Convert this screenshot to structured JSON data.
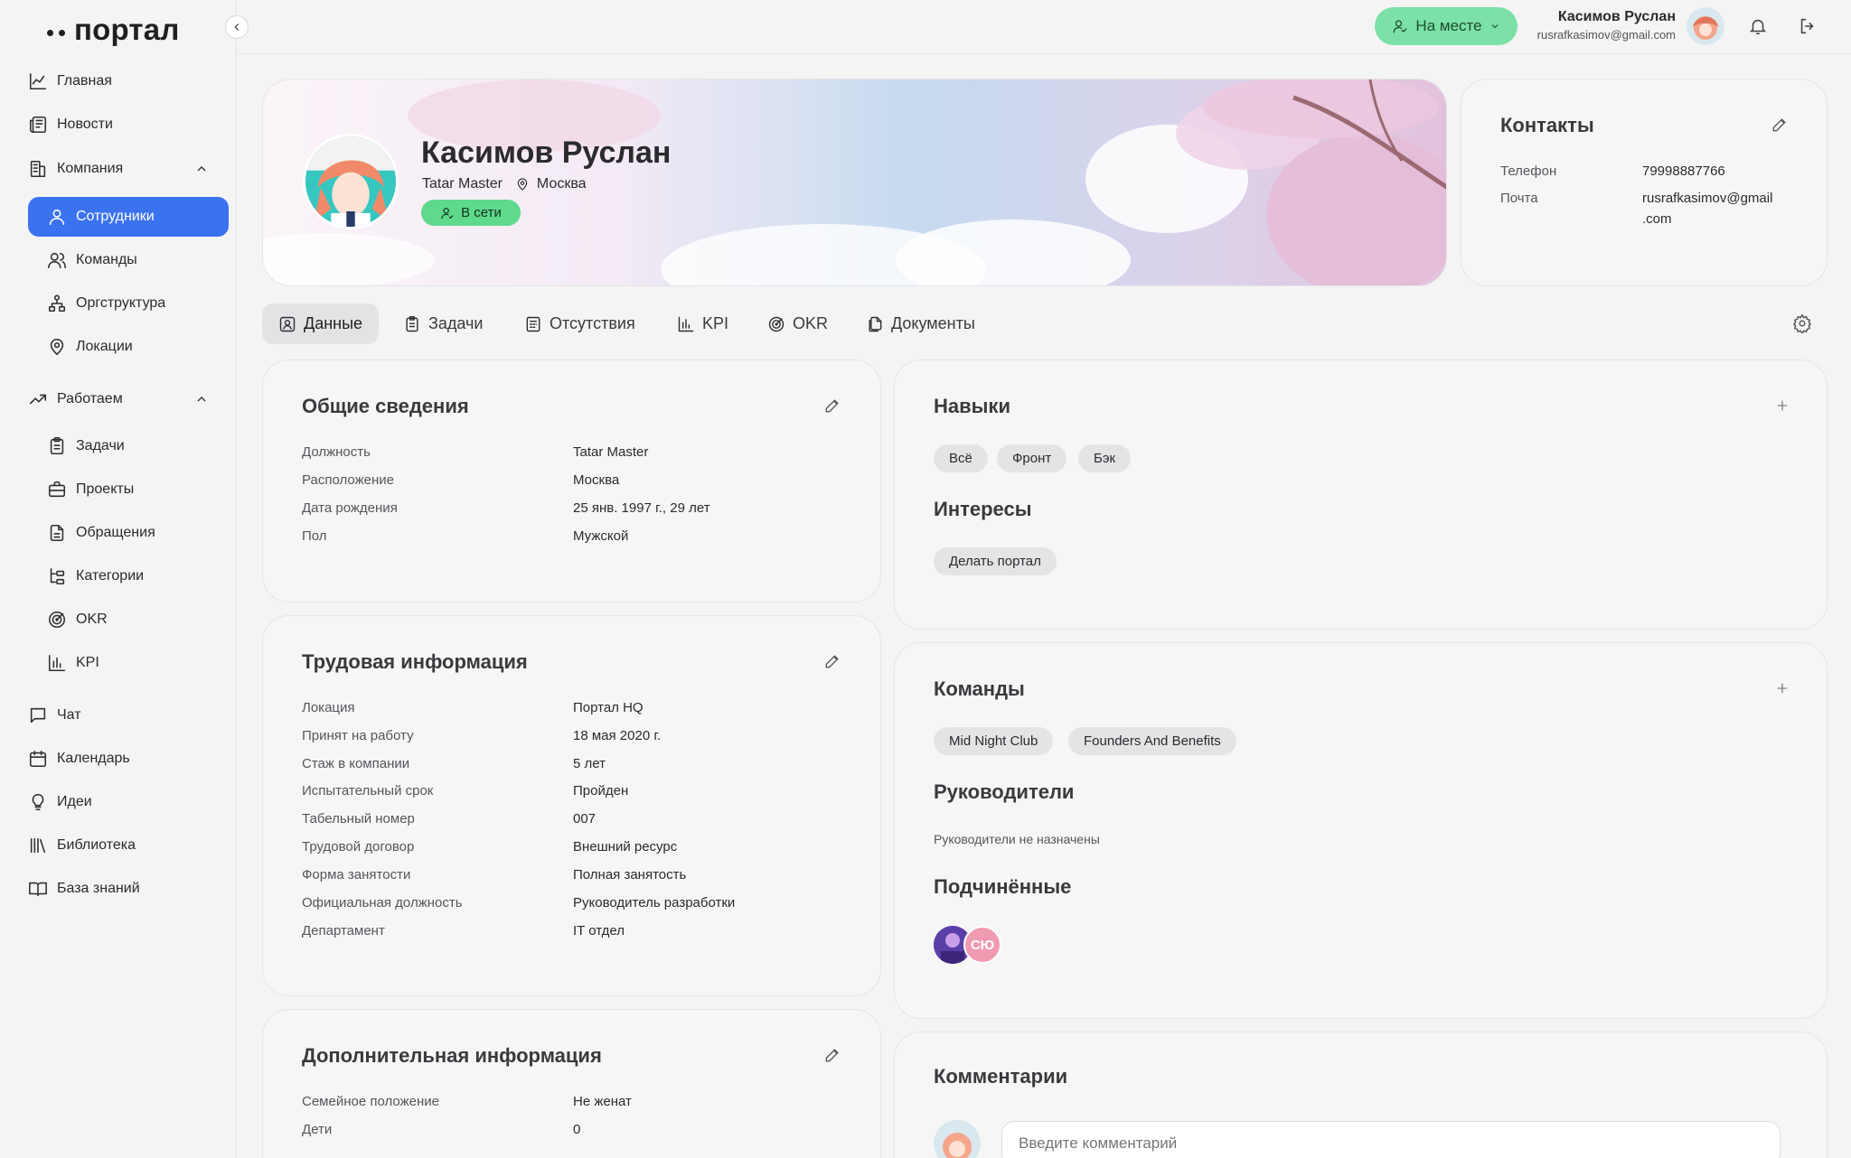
{
  "app": {
    "logo": "портал"
  },
  "sidebar": {
    "items": [
      {
        "label": "Главная",
        "icon": "chart-line-icon"
      },
      {
        "label": "Новости",
        "icon": "newspaper-icon"
      },
      {
        "label": "Компания",
        "icon": "building-icon"
      },
      {
        "label": "Сотрудники",
        "icon": "user-icon"
      },
      {
        "label": "Команды",
        "icon": "users-icon"
      },
      {
        "label": "Оргструктура",
        "icon": "org-chart-icon"
      },
      {
        "label": "Локации",
        "icon": "map-pin-icon"
      },
      {
        "label": "Работаем",
        "icon": "trending-up-icon"
      },
      {
        "label": "Задачи",
        "icon": "clipboard-icon"
      },
      {
        "label": "Проекты",
        "icon": "briefcase-icon"
      },
      {
        "label": "Обращения",
        "icon": "document-icon"
      },
      {
        "label": "Категории",
        "icon": "tree-icon"
      },
      {
        "label": "OKR",
        "icon": "target-icon"
      },
      {
        "label": "KPI",
        "icon": "bar-chart-icon"
      },
      {
        "label": "Чат",
        "icon": "chat-icon"
      },
      {
        "label": "Календарь",
        "icon": "calendar-icon"
      },
      {
        "label": "Идеи",
        "icon": "lightbulb-icon"
      },
      {
        "label": "Библиотека",
        "icon": "library-icon"
      },
      {
        "label": "База знаний",
        "icon": "book-icon"
      }
    ]
  },
  "header": {
    "status_label": "На месте",
    "user_name": "Касимов Руслан",
    "user_email": "rusrafkasimov@gmail.com"
  },
  "profile": {
    "name": "Касимов Руслан",
    "position": "Tatar Master",
    "city": "Москва",
    "online_label": "В сети"
  },
  "contacts": {
    "title": "Контакты",
    "phone_label": "Телефон",
    "phone": "79998887766",
    "email_label": "Почта",
    "email_line1": "rusrafkasimov@gmail",
    "email_line2": ".com"
  },
  "tabs": [
    {
      "label": "Данные",
      "icon": "id-card-icon"
    },
    {
      "label": "Задачи",
      "icon": "clipboard-icon"
    },
    {
      "label": "Отсутствия",
      "icon": "calendar-grid-icon"
    },
    {
      "label": "KPI",
      "icon": "bar-chart-icon"
    },
    {
      "label": "OKR",
      "icon": "target-icon"
    },
    {
      "label": "Документы",
      "icon": "documents-icon"
    }
  ],
  "general": {
    "title": "Общие сведения",
    "rows": [
      {
        "label": "Должность",
        "value": "Tatar Master"
      },
      {
        "label": "Расположение",
        "value": "Москва"
      },
      {
        "label": "Дата рождения",
        "value": "25 янв. 1997 г., 29 лет"
      },
      {
        "label": "Пол",
        "value": "Мужской"
      }
    ]
  },
  "work": {
    "title": "Трудовая информация",
    "rows": [
      {
        "label": "Локация",
        "value": "Портал HQ"
      },
      {
        "label": "Принят на работу",
        "value": "18 мая 2020 г."
      },
      {
        "label": "Стаж в компании",
        "value": "5 лет"
      },
      {
        "label": "Испытательный срок",
        "value": "Пройден"
      },
      {
        "label": "Табельный номер",
        "value": "007"
      },
      {
        "label": "Трудовой договор",
        "value": "Внешний ресурс"
      },
      {
        "label": "Форма занятости",
        "value": "Полная занятость"
      },
      {
        "label": "Официальная должность",
        "value": "Руководитель разработки"
      },
      {
        "label": "Департамент",
        "value": "IT отдел"
      }
    ]
  },
  "extra": {
    "title": "Дополнительная информация",
    "rows": [
      {
        "label": "Семейное положение",
        "value": "Не женат"
      },
      {
        "label": "Дети",
        "value": "0"
      }
    ]
  },
  "skills": {
    "title": "Навыки",
    "chips": [
      "Всё",
      "Фронт",
      "Бэк"
    ],
    "interests_title": "Интересы",
    "interests": [
      "Делать портал"
    ]
  },
  "teams": {
    "title": "Команды",
    "chips": [
      "Mid Night Club",
      "Founders And Benefits"
    ],
    "managers_title": "Руководители",
    "managers_empty": "Руководители не назначены",
    "subordinates_title": "Подчинённые",
    "subordinate_initials": "СЮ"
  },
  "comments": {
    "title": "Комментарии",
    "placeholder": "Введите комментарий"
  },
  "colors": {
    "accent": "#3b72f0",
    "online": "#5fd98c",
    "status": "#7be1a6"
  }
}
